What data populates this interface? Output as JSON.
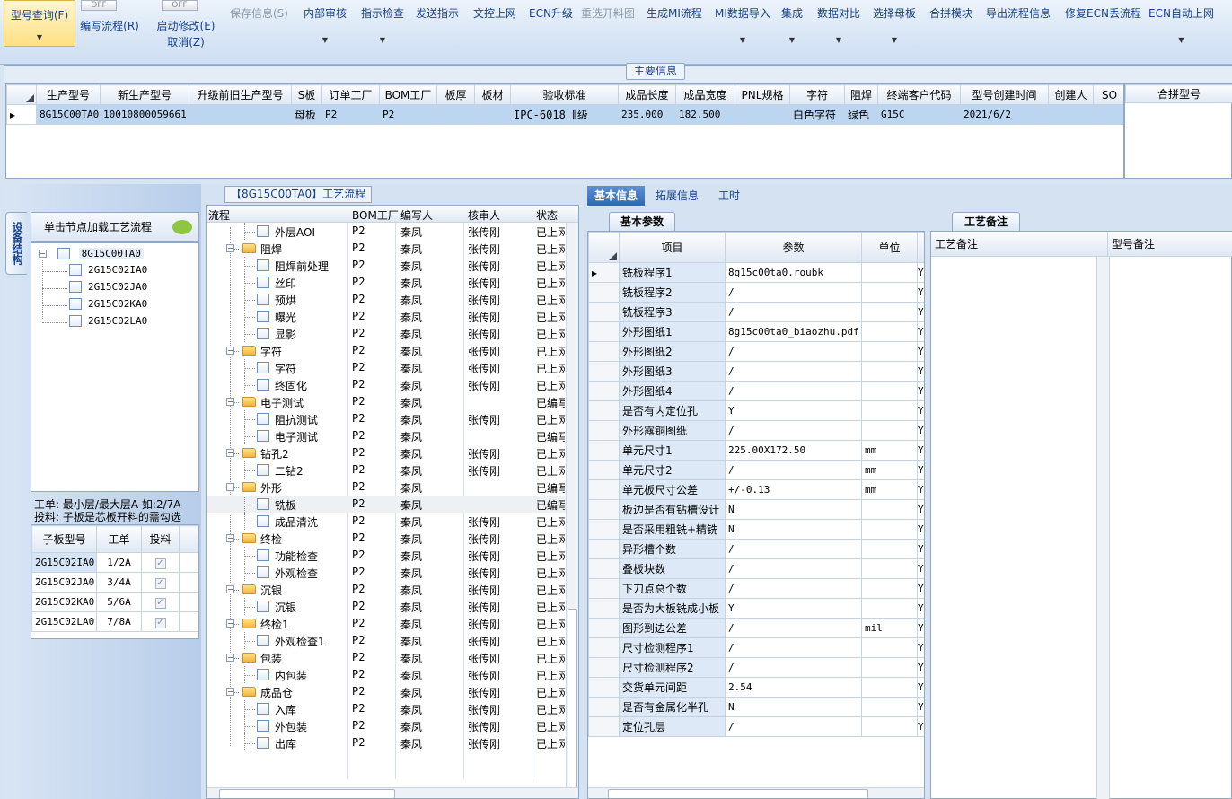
{
  "toolbar": {
    "query": "型号查询(F)",
    "off": "OFF",
    "edit_flow": "编写流程(R)",
    "start_modify": "启动修改(E)",
    "cancel": "取消(Z)",
    "items": [
      {
        "label": "保存信息(S)",
        "disabled": true,
        "dropdown": false
      },
      {
        "label": "内部审核",
        "disabled": false,
        "dropdown": true
      },
      {
        "label": "指示检查",
        "disabled": false,
        "dropdown": true
      },
      {
        "label": "发送指示",
        "disabled": false,
        "dropdown": false
      },
      {
        "label": "文控上网",
        "disabled": false,
        "dropdown": false
      },
      {
        "label": "ECN升级",
        "disabled": false,
        "dropdown": false
      },
      {
        "label": "重选开料图",
        "disabled": true,
        "dropdown": false
      },
      {
        "label": "生成MI流程",
        "disabled": false,
        "dropdown": false
      },
      {
        "label": "MI数据导入",
        "disabled": false,
        "dropdown": true
      },
      {
        "label": "集成",
        "disabled": false,
        "dropdown": true
      },
      {
        "label": "数据对比",
        "disabled": false,
        "dropdown": true
      },
      {
        "label": "选择母板",
        "disabled": false,
        "dropdown": true
      },
      {
        "label": "合拼模块",
        "disabled": false,
        "dropdown": false
      },
      {
        "label": "导出流程信息",
        "disabled": false,
        "dropdown": false
      },
      {
        "label": "修复ECN丢流程",
        "disabled": false,
        "dropdown": false
      },
      {
        "label": "ECN自动上网",
        "disabled": false,
        "dropdown": true
      }
    ]
  },
  "main_info": {
    "title": "主要信息",
    "columns": [
      "生产型号",
      "新生产型号",
      "升级前旧生产型号",
      "S板",
      "订单工厂",
      "BOM工厂",
      "板厚",
      "板材",
      "验收标准",
      "成品长度",
      "成品宽度",
      "PNL规格",
      "字符",
      "阻焊",
      "终端客户代码",
      "型号创建时间",
      "创建人",
      "SO"
    ],
    "row": [
      "8G15C00TA0",
      "10010800059661",
      "",
      "母板",
      "P2",
      "P2",
      "",
      "",
      "IPC-6018 Ⅱ级",
      "235.000",
      "182.500",
      "",
      "白色字符",
      "绿色",
      "G15C",
      "2021/6/2",
      "",
      ""
    ],
    "merge_col": "合拼型号"
  },
  "sidebar": {
    "vtab": "设备结构",
    "hint": "单击节点加载工艺流程",
    "tree_root": "8G15C00TA0",
    "tree_children": [
      "2G15C02IA0",
      "2G15C02JA0",
      "2G15C02KA0",
      "2G15C02LA0"
    ],
    "note1": "工单: 最小层/最大层A 如:2/7A",
    "note2": "投料: 子板是芯板开料的需勾选",
    "sub_cols": [
      "子板型号",
      "工单",
      "投料"
    ],
    "sub_rows": [
      [
        "2G15C02IA0",
        "1/2A"
      ],
      [
        "2G15C02JA0",
        "3/4A"
      ],
      [
        "2G15C02KA0",
        "5/6A"
      ],
      [
        "2G15C02LA0",
        "7/8A"
      ]
    ]
  },
  "process": {
    "title": "【8G15C00TA0】工艺流程",
    "cols": [
      "流程",
      "BOM工厂",
      "编写人",
      "核审人",
      "状态"
    ],
    "rows": [
      {
        "name": "外层AOI",
        "level": 2,
        "folder": false,
        "bom": "P2",
        "writer": "秦凤",
        "reviewer": "张传刚",
        "status": "已上网"
      },
      {
        "name": "阻焊",
        "level": 1,
        "folder": true,
        "bom": "P2",
        "writer": "秦凤",
        "reviewer": "张传刚",
        "status": "已上网"
      },
      {
        "name": "阻焊前处理",
        "level": 2,
        "folder": false,
        "bom": "P2",
        "writer": "秦凤",
        "reviewer": "张传刚",
        "status": "已上网"
      },
      {
        "name": "丝印",
        "level": 2,
        "folder": false,
        "bom": "P2",
        "writer": "秦凤",
        "reviewer": "张传刚",
        "status": "已上网"
      },
      {
        "name": "预烘",
        "level": 2,
        "folder": false,
        "bom": "P2",
        "writer": "秦凤",
        "reviewer": "张传刚",
        "status": "已上网"
      },
      {
        "name": "曝光",
        "level": 2,
        "folder": false,
        "bom": "P2",
        "writer": "秦凤",
        "reviewer": "张传刚",
        "status": "已上网"
      },
      {
        "name": "显影",
        "level": 2,
        "folder": false,
        "bom": "P2",
        "writer": "秦凤",
        "reviewer": "张传刚",
        "status": "已上网"
      },
      {
        "name": "字符",
        "level": 1,
        "folder": true,
        "bom": "P2",
        "writer": "秦凤",
        "reviewer": "张传刚",
        "status": "已上网"
      },
      {
        "name": "字符",
        "level": 2,
        "folder": false,
        "bom": "P2",
        "writer": "秦凤",
        "reviewer": "张传刚",
        "status": "已上网"
      },
      {
        "name": "终固化",
        "level": 2,
        "folder": false,
        "bom": "P2",
        "writer": "秦凤",
        "reviewer": "张传刚",
        "status": "已上网"
      },
      {
        "name": "电子测试",
        "level": 1,
        "folder": true,
        "bom": "P2",
        "writer": "秦凤",
        "reviewer": "",
        "status": "已编写"
      },
      {
        "name": "阻抗测试",
        "level": 2,
        "folder": false,
        "bom": "P2",
        "writer": "秦凤",
        "reviewer": "张传刚",
        "status": "已上网"
      },
      {
        "name": "电子测试",
        "level": 2,
        "folder": false,
        "bom": "P2",
        "writer": "秦凤",
        "reviewer": "",
        "status": "已编写"
      },
      {
        "name": "钻孔2",
        "level": 1,
        "folder": true,
        "bom": "P2",
        "writer": "秦凤",
        "reviewer": "张传刚",
        "status": "已上网"
      },
      {
        "name": "二钻2",
        "level": 2,
        "folder": false,
        "bom": "P2",
        "writer": "秦凤",
        "reviewer": "张传刚",
        "status": "已上网"
      },
      {
        "name": "外形",
        "level": 1,
        "folder": true,
        "bom": "P2",
        "writer": "秦凤",
        "reviewer": "",
        "status": "已编写"
      },
      {
        "name": "铣板",
        "level": 2,
        "folder": false,
        "bom": "P2",
        "writer": "秦凤",
        "reviewer": "",
        "status": "已编写",
        "selected": true
      },
      {
        "name": "成品清洗",
        "level": 2,
        "folder": false,
        "bom": "P2",
        "writer": "秦凤",
        "reviewer": "张传刚",
        "status": "已上网"
      },
      {
        "name": "终检",
        "level": 1,
        "folder": true,
        "bom": "P2",
        "writer": "秦凤",
        "reviewer": "张传刚",
        "status": "已上网"
      },
      {
        "name": "功能检查",
        "level": 2,
        "folder": false,
        "bom": "P2",
        "writer": "秦凤",
        "reviewer": "张传刚",
        "status": "已上网"
      },
      {
        "name": "外观检查",
        "level": 2,
        "folder": false,
        "bom": "P2",
        "writer": "秦凤",
        "reviewer": "张传刚",
        "status": "已上网"
      },
      {
        "name": "沉银",
        "level": 1,
        "folder": true,
        "bom": "P2",
        "writer": "秦凤",
        "reviewer": "张传刚",
        "status": "已上网"
      },
      {
        "name": "沉银",
        "level": 2,
        "folder": false,
        "bom": "P2",
        "writer": "秦凤",
        "reviewer": "张传刚",
        "status": "已上网"
      },
      {
        "name": "终检1",
        "level": 1,
        "folder": true,
        "bom": "P2",
        "writer": "秦凤",
        "reviewer": "张传刚",
        "status": "已上网"
      },
      {
        "name": "外观检查1",
        "level": 2,
        "folder": false,
        "bom": "P2",
        "writer": "秦凤",
        "reviewer": "张传刚",
        "status": "已上网"
      },
      {
        "name": "包装",
        "level": 1,
        "folder": true,
        "bom": "P2",
        "writer": "秦凤",
        "reviewer": "张传刚",
        "status": "已上网"
      },
      {
        "name": "内包装",
        "level": 2,
        "folder": false,
        "bom": "P2",
        "writer": "秦凤",
        "reviewer": "张传刚",
        "status": "已上网"
      },
      {
        "name": "成品仓",
        "level": 1,
        "folder": true,
        "bom": "P2",
        "writer": "秦凤",
        "reviewer": "张传刚",
        "status": "已上网"
      },
      {
        "name": "入库",
        "level": 2,
        "folder": false,
        "bom": "P2",
        "writer": "秦凤",
        "reviewer": "张传刚",
        "status": "已上网"
      },
      {
        "name": "外包装",
        "level": 2,
        "folder": false,
        "bom": "P2",
        "writer": "秦凤",
        "reviewer": "张传刚",
        "status": "已上网"
      },
      {
        "name": "出库",
        "level": 2,
        "folder": false,
        "bom": "P2",
        "writer": "秦凤",
        "reviewer": "张传刚",
        "status": "已上网"
      }
    ]
  },
  "right_tabs": [
    "基本信息",
    "拓展信息",
    "工时"
  ],
  "basic": {
    "subtab": "基本参数",
    "cols": [
      "项目",
      "参数",
      "单位"
    ],
    "rows": [
      [
        "铣板程序1",
        "8g15c00ta0.roubk",
        "",
        "Y"
      ],
      [
        "铣板程序2",
        "/",
        "",
        "Y"
      ],
      [
        "铣板程序3",
        "/",
        "",
        "Y"
      ],
      [
        "外形图纸1",
        "8g15c00ta0_biaozhu.pdf",
        "",
        "Y"
      ],
      [
        "外形图纸2",
        "/",
        "",
        "Y"
      ],
      [
        "外形图纸3",
        "/",
        "",
        "Y"
      ],
      [
        "外形图纸4",
        "/",
        "",
        "Y"
      ],
      [
        "是否有内定位孔",
        "Y",
        "",
        "Y"
      ],
      [
        "外形露铜图纸",
        "/",
        "",
        "Y"
      ],
      [
        "单元尺寸1",
        "225.00X172.50",
        "mm",
        "Y"
      ],
      [
        "单元尺寸2",
        "/",
        "mm",
        "Y"
      ],
      [
        "单元板尺寸公差",
        "+/-0.13",
        "mm",
        "Y"
      ],
      [
        "板边是否有钻槽设计",
        "N",
        "",
        "Y"
      ],
      [
        "是否采用粗铣+精铣",
        "N",
        "",
        "Y"
      ],
      [
        "异形槽个数",
        "/",
        "",
        "Y"
      ],
      [
        "叠板块数",
        "/",
        "",
        "Y"
      ],
      [
        "下刀点总个数",
        "/",
        "",
        "Y"
      ],
      [
        "是否为大板铣成小板",
        "Y",
        "",
        "Y"
      ],
      [
        "图形到边公差",
        "/",
        "mil",
        "Y"
      ],
      [
        "尺寸检测程序1",
        "/",
        "",
        "Y"
      ],
      [
        "尺寸检测程序2",
        "/",
        "",
        "Y"
      ],
      [
        "交货单元间距",
        "2.54",
        "",
        "Y"
      ],
      [
        "是否有金属化半孔",
        "N",
        "",
        "Y"
      ],
      [
        "定位孔层",
        "/",
        "",
        "Y"
      ]
    ]
  },
  "remark": {
    "subtab": "工艺备注",
    "col1": "工艺备注",
    "col2": "型号备注"
  }
}
